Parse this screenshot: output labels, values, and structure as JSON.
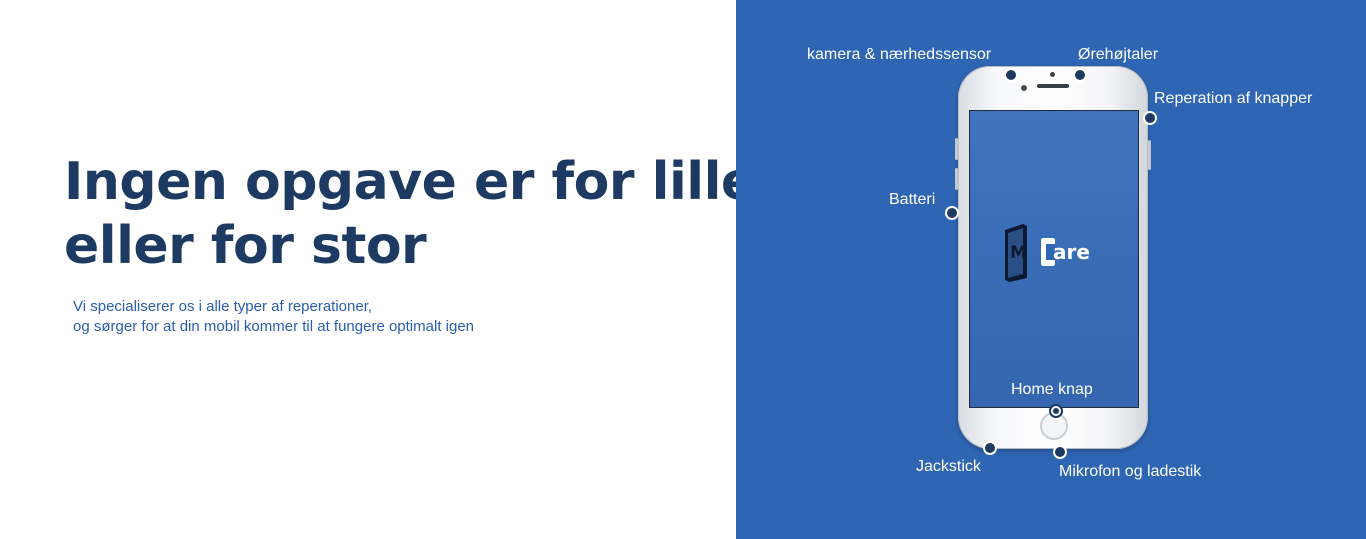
{
  "hero": {
    "headline_line1": "Ingen opgave er for lille",
    "headline_line2": "eller for stor",
    "subtitle_line1": "Vi specialiserer os i alle typer af reperationer,",
    "subtitle_line2": "og sørger for at din mobil kommer til at fungere optimalt igen"
  },
  "diagram": {
    "logo_text": "MCare",
    "labels": {
      "camera": "kamera & nærhedssensor",
      "earpiece": "Ørehøjtaler",
      "buttons": "Reperation af knapper",
      "battery": "Batteri",
      "home": "Home knap",
      "jack": "Jackstick",
      "mic": "Mikrofon og ladestik"
    }
  },
  "colors": {
    "headline": "#1d3a63",
    "subtitle": "#2a5eb0",
    "panel": "#2f66b4"
  }
}
